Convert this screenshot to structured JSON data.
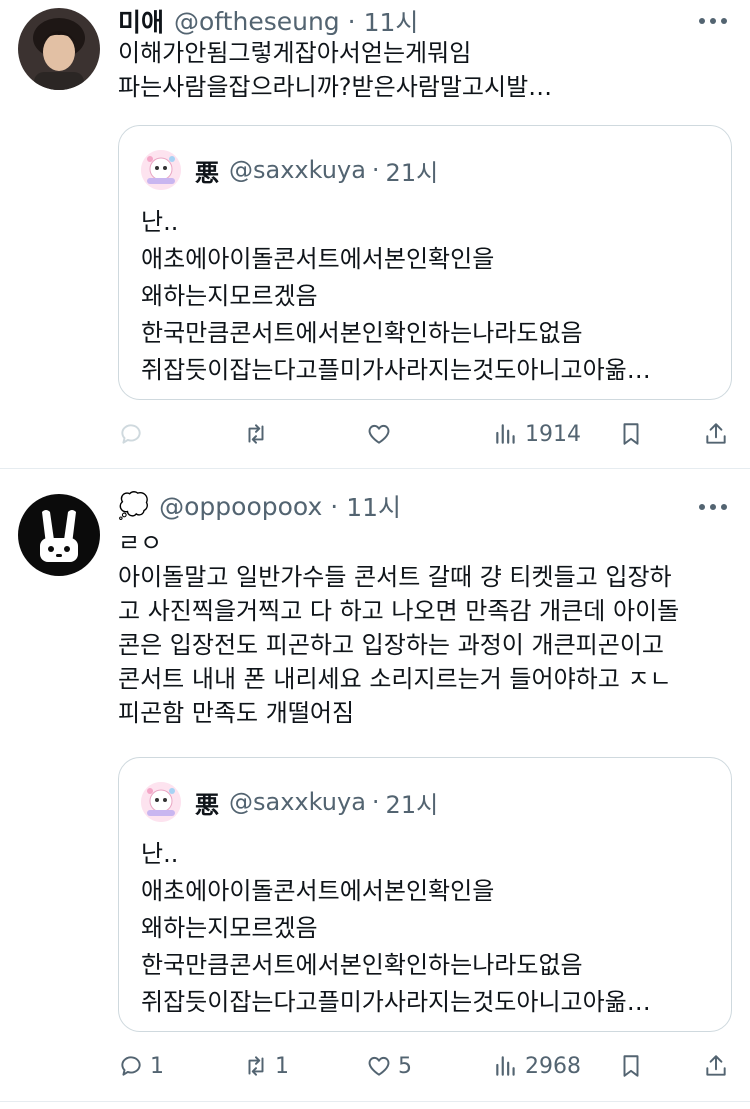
{
  "tweets": [
    {
      "author_name": "미애",
      "handle": "@oftheseung",
      "separator": "·",
      "time": "11시",
      "text_lines": [
        "이해가안됨그렇게잡아서얻는게뭐임",
        "파는사람을잡으라니까?받은사람말고시발…"
      ],
      "quote": {
        "author_name": "悪",
        "handle": "@saxxkuya",
        "separator": "·",
        "time": "21시",
        "text_lines": [
          "난..",
          "애초에아이돌콘서트에서본인확인을",
          "왜하는지모르겠음",
          "한국만큼콘서트에서본인확인하는나라도없음",
          "쥐잡듯이잡는다고플미가사라지는것도아니고아옮…"
        ]
      },
      "actions": {
        "reply": "",
        "retweet": "",
        "like": "",
        "views": "1914"
      }
    },
    {
      "author_name": "💭",
      "handle": "@oppoopoox",
      "separator": "·",
      "time": "11시",
      "text_lines": [
        "ㄹㅇ",
        "아이돌말고 일반가수들 콘서트 갈때 걍 티켓들고 입장하",
        "고 사진찍을거찍고 다 하고 나오면 만족감 개큰데 아이돌",
        "콘은 입장전도 피곤하고 입장하는 과정이 개큰피곤이고",
        "콘서트 내내 폰 내리세요 소리지르는거 들어야하고 ㅈㄴ",
        "피곤함 만족도 개떨어짐"
      ],
      "quote": {
        "author_name": "悪",
        "handle": "@saxxkuya",
        "separator": "·",
        "time": "21시",
        "text_lines": [
          "난..",
          "애초에아이돌콘서트에서본인확인을",
          "왜하는지모르겠음",
          "한국만큼콘서트에서본인확인하는나라도없음",
          "쥐잡듯이잡는다고플미가사라지는것도아니고아옮…"
        ]
      },
      "actions": {
        "reply": "1",
        "retweet": "1",
        "like": "5",
        "views": "2968"
      }
    }
  ],
  "icons": {
    "reply": "reply-icon",
    "retweet": "retweet-icon",
    "like": "heart-icon",
    "views": "views-icon",
    "bookmark": "bookmark-icon",
    "share": "share-icon",
    "more": "more-icon"
  },
  "colors": {
    "text": "#0f1419",
    "secondary": "#536471",
    "border": "#cfd9de"
  }
}
